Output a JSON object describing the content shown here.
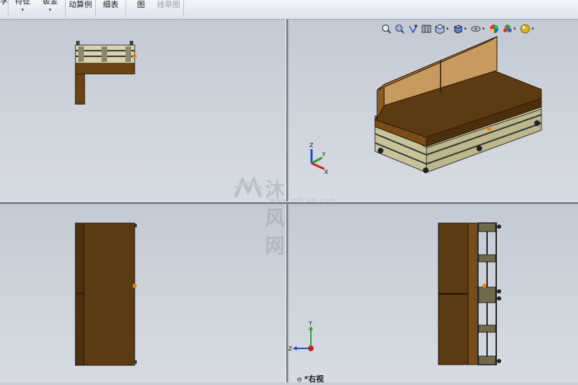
{
  "ribbon": {
    "items": [
      {
        "label": "孚",
        "dropdown": false,
        "disabled": false
      },
      {
        "label": "特征",
        "dropdown": true,
        "disabled": false
      },
      {
        "label": "钣金",
        "dropdown": true,
        "disabled": false
      },
      {
        "label": "动算例",
        "dropdown": false,
        "disabled": false
      },
      {
        "label": "细表",
        "dropdown": false,
        "disabled": false
      },
      {
        "label": "图",
        "dropdown": false,
        "disabled": false
      },
      {
        "label": "线草图",
        "dropdown": false,
        "disabled": true
      }
    ]
  },
  "heads_up_toolbar": {
    "icons": [
      "zoom-to-fit-icon",
      "zoom-to-area-icon",
      "previous-view-icon",
      "section-view-icon",
      "view-orientation-icon",
      "display-style-icon",
      "hide-show-items-icon",
      "edit-appearance-icon",
      "apply-scene-icon",
      "view-settings-icon"
    ]
  },
  "viewports": {
    "bottom_right_label": "*右视",
    "triad_top_right": {
      "x": "X",
      "y": "Y",
      "z": "Z"
    },
    "triad_bottom_right": {
      "y": "Y",
      "z": "Z"
    }
  },
  "watermark": {
    "text": "沐风网",
    "url": "www.mfcad.com"
  },
  "colors": {
    "viewport_bg": "#c9cfd8",
    "wood": "#5c3a12",
    "cushion": "#c79a5f",
    "pallet": "#d7d2ac",
    "accent_orange": "#e8821c"
  }
}
